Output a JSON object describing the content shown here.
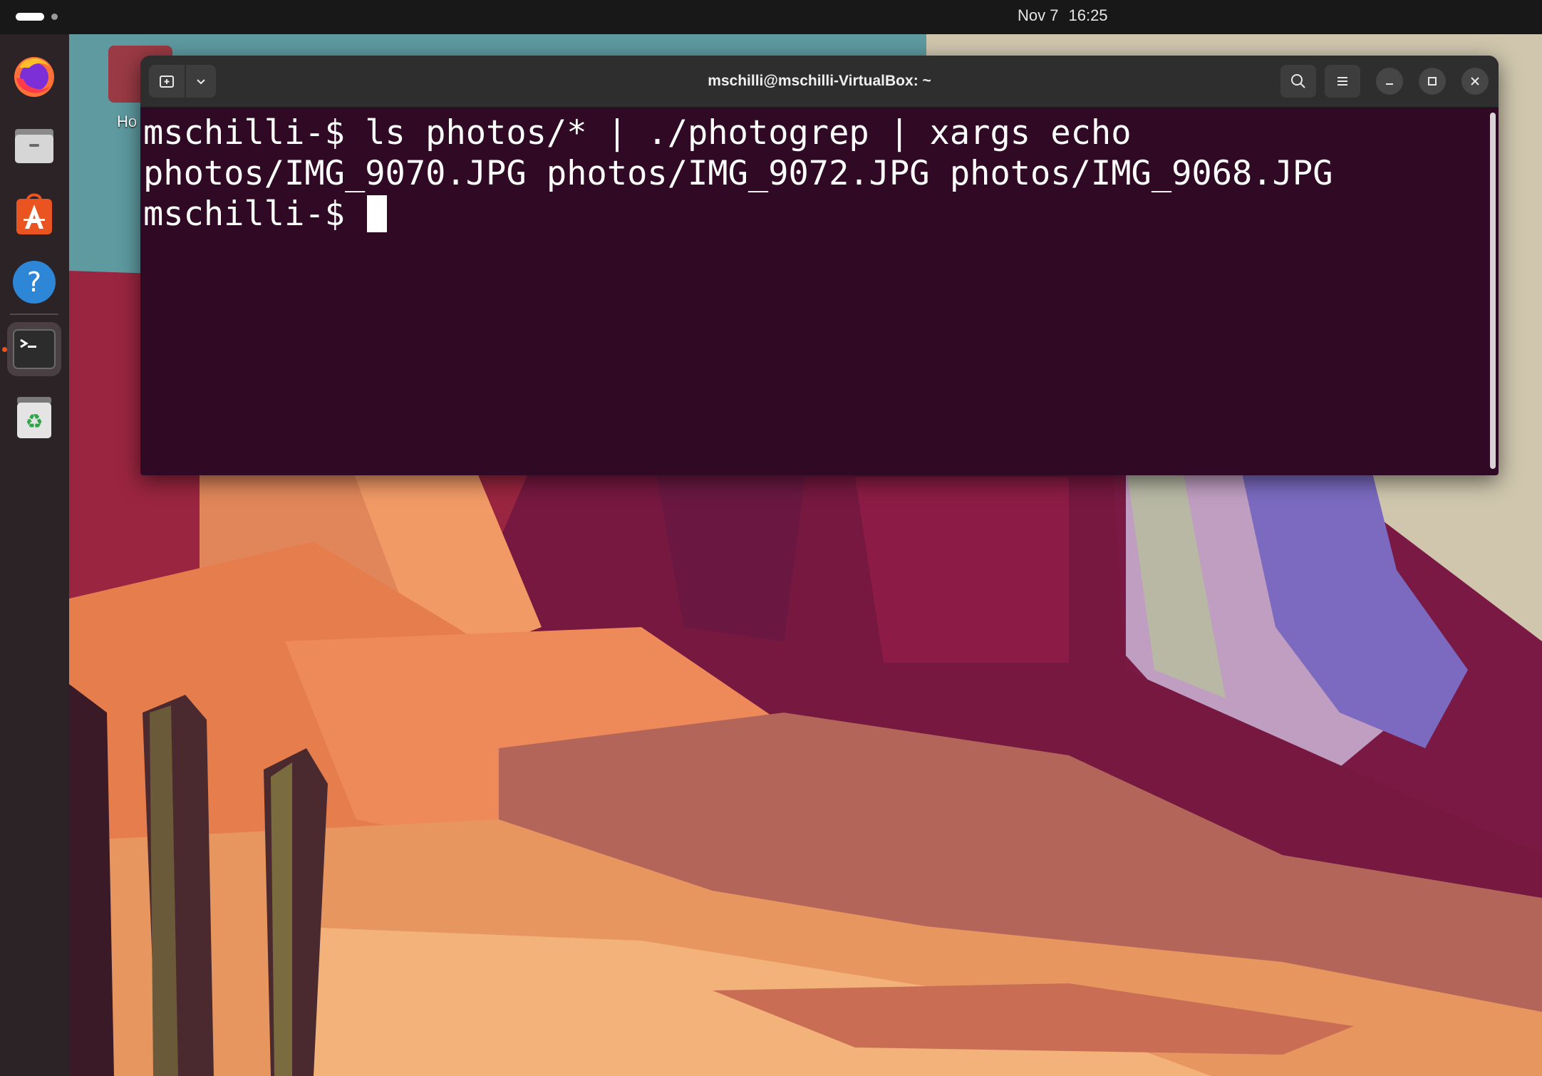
{
  "topbar": {
    "date": "Nov 7",
    "time": "16:25"
  },
  "dock": {
    "items": [
      {
        "name": "Firefox",
        "icon": "firefox-icon"
      },
      {
        "name": "Files",
        "icon": "files-icon"
      },
      {
        "name": "App Center",
        "icon": "app-center-icon"
      },
      {
        "name": "Help",
        "icon": "help-icon"
      },
      {
        "name": "Terminal",
        "icon": "terminal-icon",
        "active": true
      },
      {
        "name": "Trash",
        "icon": "trash-icon"
      }
    ]
  },
  "desktop": {
    "home_label": "Ho"
  },
  "terminal": {
    "title": "mschilli@mschilli-VirtualBox: ~",
    "lines": [
      "mschilli-$ ls photos/* | ./photogrep | xargs echo",
      "photos/IMG_9070.JPG photos/IMG_9072.JPG photos/IMG_9068.JPG",
      "mschilli-$ "
    ],
    "background": "#300a24",
    "foreground": "#ffffff"
  },
  "colors": {
    "accent": "#e95420",
    "titlebar": "#2e2e2e",
    "topbar": "#181818",
    "dock": "#2b2326"
  }
}
